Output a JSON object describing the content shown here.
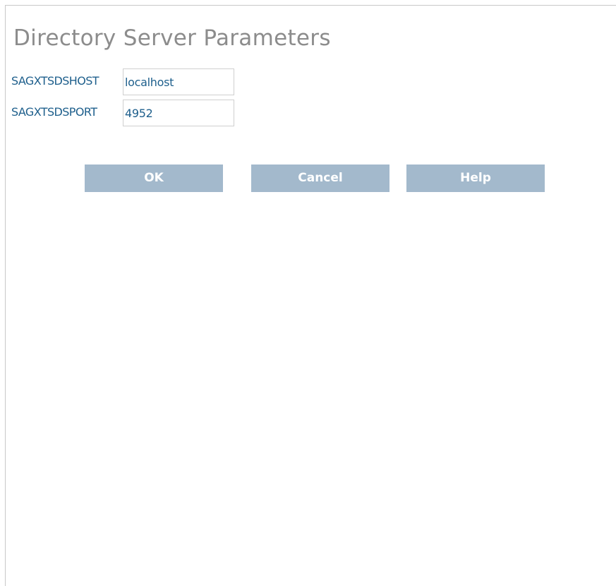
{
  "page": {
    "title": "Directory Server Parameters"
  },
  "fields": [
    {
      "label": "SAGXTSDSHOST",
      "value": "localhost"
    },
    {
      "label": "SAGXTSDSPORT",
      "value": "4952"
    }
  ],
  "buttons": {
    "ok": "OK",
    "cancel": "Cancel",
    "help": "Help"
  },
  "colors": {
    "title": "#8c8c8c",
    "label": "#1e5f8c",
    "button_bg": "#a3b9cc",
    "button_text": "#ffffff",
    "border": "#c8c8c8"
  }
}
